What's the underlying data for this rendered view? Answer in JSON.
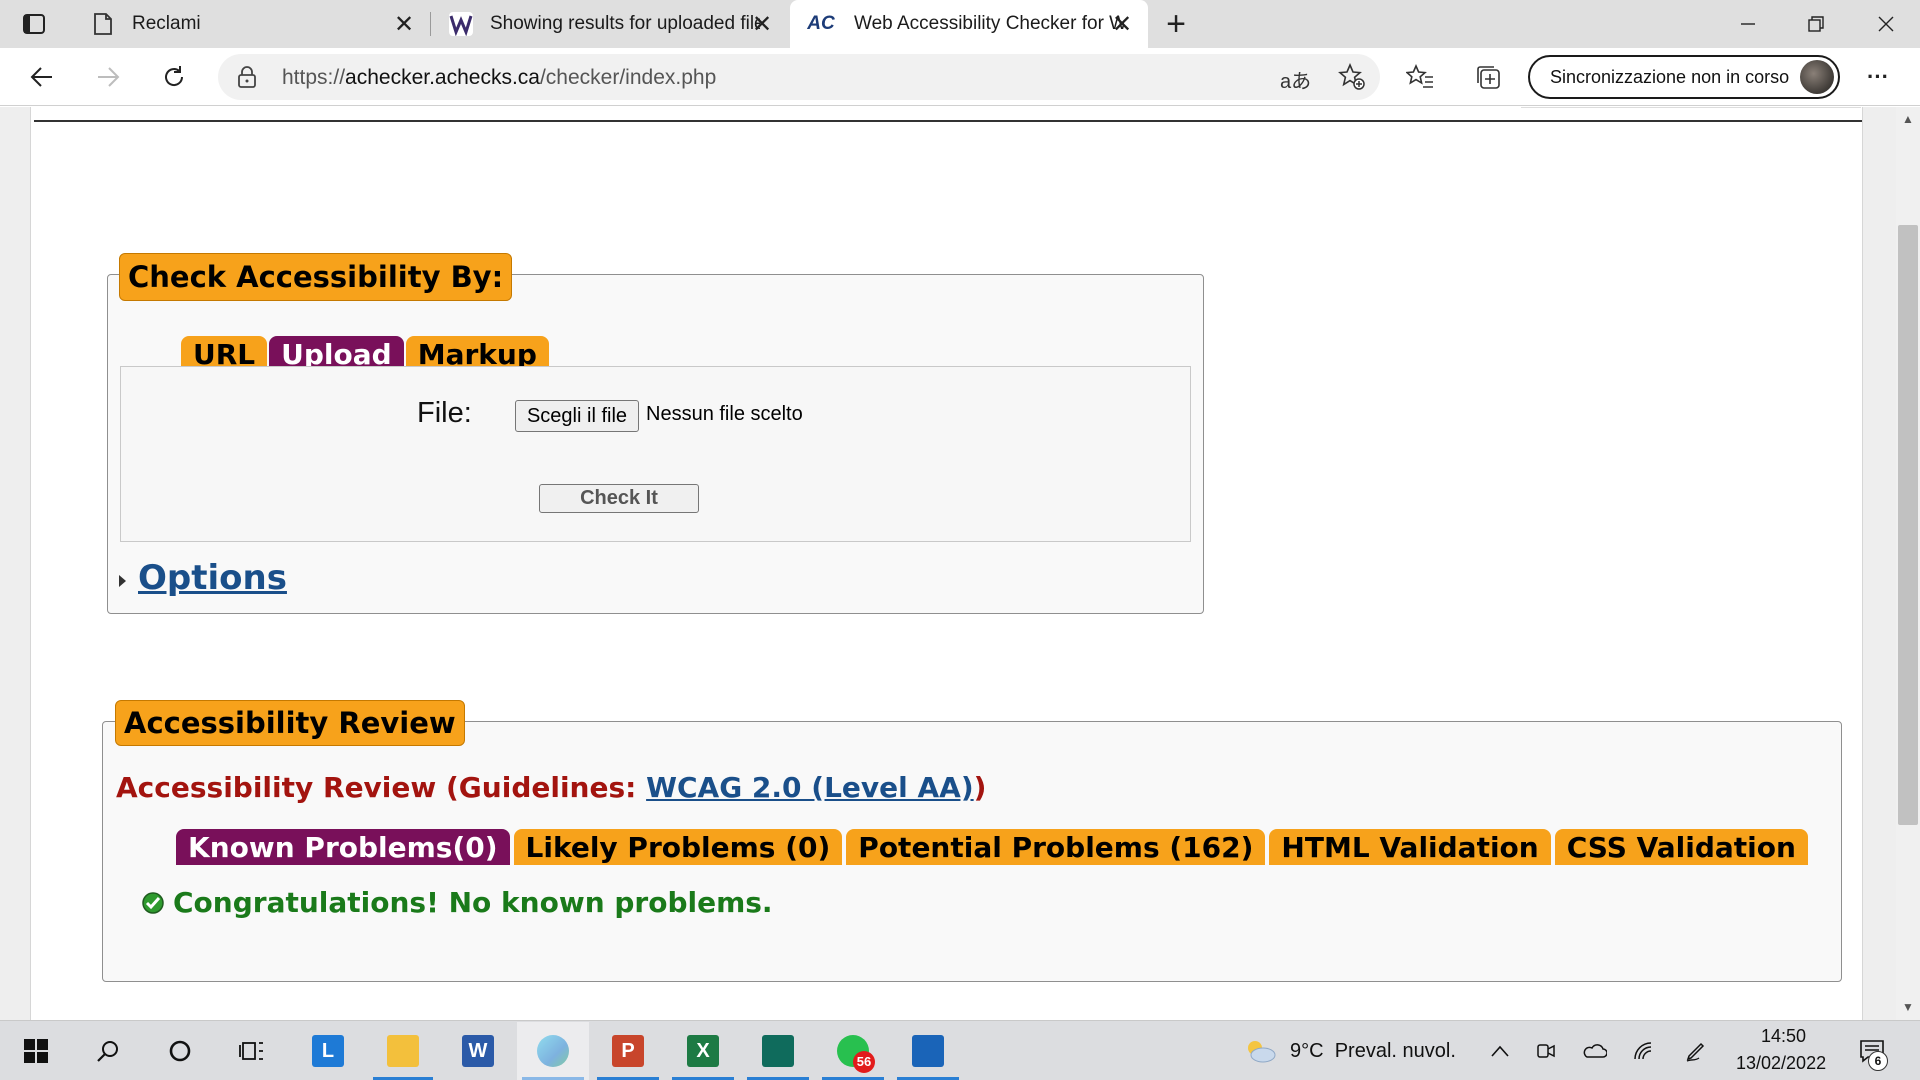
{
  "browser": {
    "tabs": [
      {
        "title": "Reclami",
        "icon": "page-icon"
      },
      {
        "title": "Showing results for uploaded file",
        "icon": "wave-logo-icon"
      },
      {
        "title": "Web Accessibility Checker for WCAG",
        "icon": "ac-logo-icon",
        "favicon_text": "AC",
        "active": true
      }
    ],
    "new_tab_label": "+",
    "address": {
      "scheme": "https://",
      "host": "achecker.achecks.ca",
      "path": "/checker/index.php"
    },
    "sync_label": "Sincronizzazione non in corso"
  },
  "page": {
    "check_section": {
      "legend": "Check Accessibility By:",
      "tabs": [
        {
          "label": "URL",
          "active": false
        },
        {
          "label": "Upload",
          "active": true
        },
        {
          "label": "Markup",
          "active": false
        }
      ],
      "file_label": "File:",
      "file_button": "Scegli il file",
      "file_status": "Nessun file scelto",
      "check_button": "Check It",
      "options_label": "Options"
    },
    "review_section": {
      "legend": "Accessibility Review",
      "title_prefix": "Accessibility Review (Guidelines: ",
      "guideline_link": "WCAG 2.0 (Level AA)",
      "title_suffix": ")",
      "tabs": [
        {
          "label": "Known Problems(0)",
          "active": true
        },
        {
          "label": "Likely Problems (0)",
          "active": false
        },
        {
          "label": "Potential Problems (162)",
          "active": false
        },
        {
          "label": "HTML Validation",
          "active": false
        },
        {
          "label": "CSS Validation",
          "active": false
        }
      ],
      "result_message": "Congratulations! No known problems."
    }
  },
  "taskbar": {
    "weather": {
      "temp": "9°C",
      "desc": "Preval. nuvol."
    },
    "clock": {
      "time": "14:50",
      "date": "13/02/2022"
    },
    "whatsapp_badge": "56",
    "notification_count": "6",
    "apps": [
      "start-icon",
      "search-icon",
      "cortana-icon",
      "task-view-icon",
      "lexmark-app-icon",
      "file-explorer-icon",
      "word-icon",
      "edge-icon",
      "powerpoint-icon",
      "excel-icon",
      "publisher-icon",
      "whatsapp-icon",
      "photos-icon"
    ]
  },
  "colors": {
    "legend_bg": "#f7a21b",
    "active_tab_bg": "#79105a",
    "review_title": "#a3140f",
    "link": "#1a4f8a",
    "success": "#1a7a1a"
  }
}
